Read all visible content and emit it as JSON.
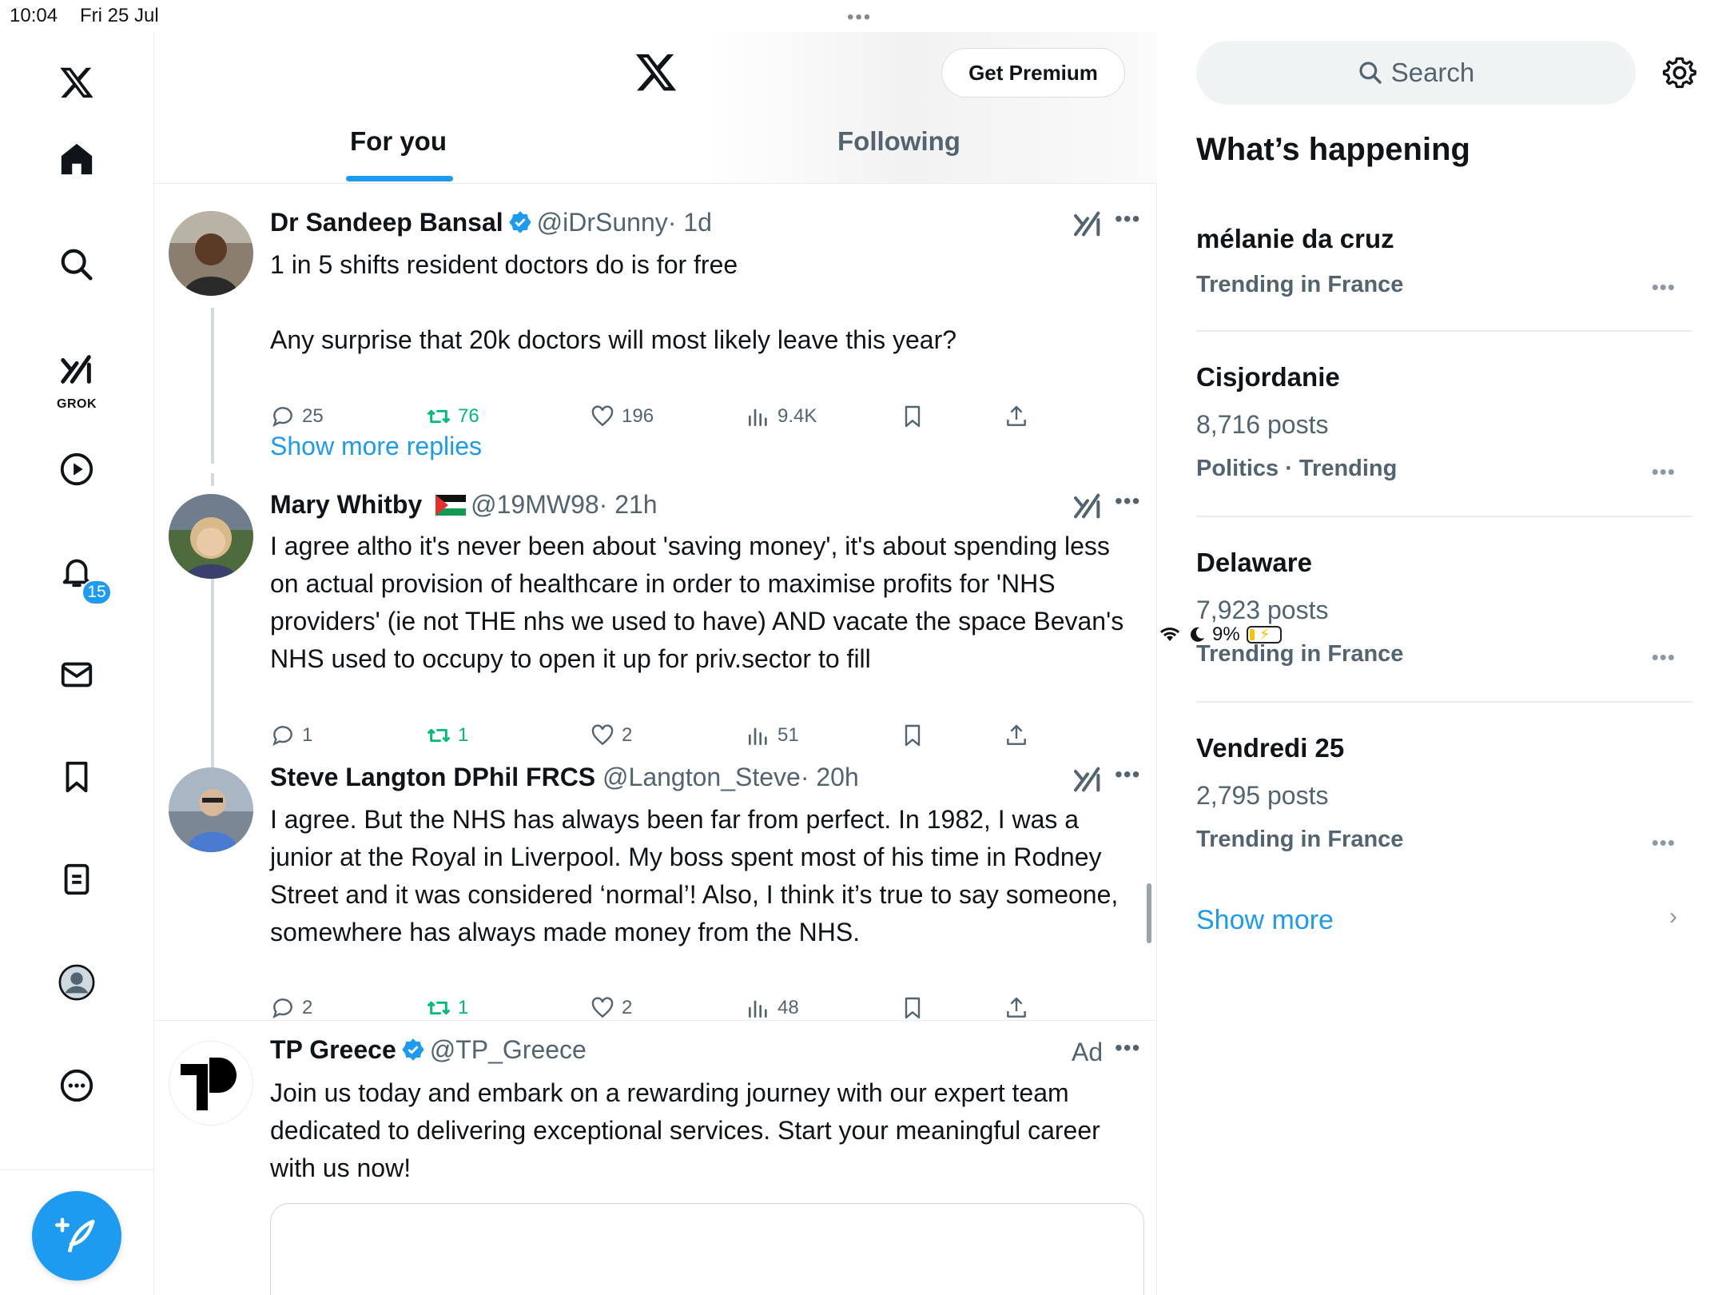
{
  "status_bar": {
    "time": "10:04",
    "date": "Fri 25 Jul",
    "battery": "9%"
  },
  "nav": {
    "grok_label": "GROK",
    "notifications_count": "15",
    "icons": [
      "x-logo-icon",
      "home-icon",
      "search-icon",
      "grok-icon",
      "video-icon",
      "bell-icon",
      "mail-icon",
      "bookmark-icon",
      "list-icon",
      "avatar",
      "more-icon",
      "compose-icon"
    ]
  },
  "header": {
    "premium_label": "Get Premium",
    "tabs": [
      {
        "label": "For you"
      },
      {
        "label": "Following"
      }
    ]
  },
  "tweets": [
    {
      "name": "Dr Sandeep Bansal",
      "handle": "@iDrSunny",
      "time": "· 1d",
      "text_line1": "1 in 5 shifts resident doctors do is for free",
      "text_line2": "Any surprise that 20k doctors will most likely leave this year?",
      "replies": "25",
      "retweets": "76",
      "likes": "196",
      "views": "9.4K"
    },
    {
      "name": "Mary Whitby",
      "handle": "@19MW98",
      "time": "· 21h",
      "text": "I agree altho it's never been about 'saving money', it's about spending less on actual provision of healthcare in order to maximise profits for 'NHS providers' (ie not THE nhs we used to have) AND vacate the space Bevan's NHS used to occupy to open it up for priv.sector to fill",
      "replies": "1",
      "retweets": "1",
      "likes": "2",
      "views": "51"
    },
    {
      "name": "Steve Langton DPhil FRCS",
      "handle": "@Langton_Steve",
      "time": "· 20h",
      "text": "I agree. But the NHS has always been far from perfect. In 1982, I was a junior at the Royal in Liverpool. My boss spent most of his time in Rodney Street and it was considered ‘normal’! Also, I think it’s true to say someone, somewhere has always made money from the NHS.",
      "replies": "2",
      "retweets": "1",
      "likes": "2",
      "views": "48"
    },
    {
      "name": "TP Greece",
      "handle": "@TP_Greece",
      "ad_label": "Ad",
      "text": "Join us today and embark on a rewarding journey with our expert team dedicated to delivering exceptional services. Start your meaningful career with us now!"
    }
  ],
  "show_more_replies": "Show more replies",
  "sidebar": {
    "search_placeholder": "Search",
    "heading": "What’s happening",
    "trends": [
      {
        "title": "mélanie da cruz",
        "posts": "",
        "context": "Trending in France"
      },
      {
        "title": "Cisjordanie",
        "posts": "8,716 posts",
        "context": "Politics · Trending"
      },
      {
        "title": "Delaware",
        "posts": "7,923 posts",
        "context": "Trending in France"
      },
      {
        "title": "Vendredi 25",
        "posts": "2,795 posts",
        "context": "Trending in France"
      }
    ],
    "show_more": "Show more"
  },
  "colors": {
    "accent": "#1d9bf0",
    "retweet": "#00ba7c",
    "secondary_text": "#536471"
  }
}
